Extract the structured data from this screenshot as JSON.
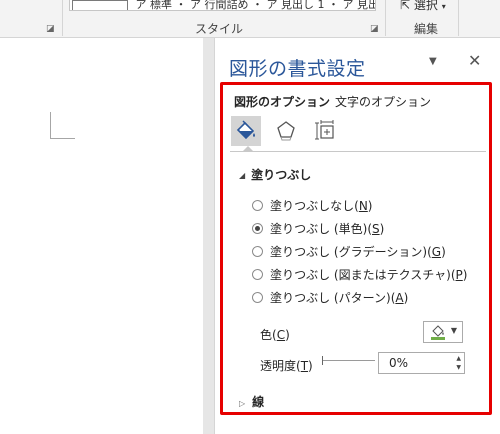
{
  "ribbon": {
    "gallery_text": "ア 標準  ・ ア 行間詰め  ・ ア 見出し 1  ・ ア 見出し 2",
    "group_styles": "スタイル",
    "select_label": "選択",
    "group_edit": "編集"
  },
  "pane": {
    "title": "図形の書式設定",
    "tabs": [
      "図形のオプション",
      "文字のオプション"
    ],
    "icons": [
      "fill-line-icon",
      "effects-icon",
      "size-properties-icon"
    ],
    "fill_section": {
      "heading": "塗りつぶし",
      "options": [
        {
          "label": "塗りつぶしなし",
          "key": "N",
          "checked": false
        },
        {
          "label": "塗りつぶし (単色)",
          "key": "S",
          "checked": true
        },
        {
          "label": "塗りつぶし (グラデーション)",
          "key": "G",
          "checked": false
        },
        {
          "label": "塗りつぶし (図またはテクスチャ)",
          "key": "P",
          "checked": false
        },
        {
          "label": "塗りつぶし (パターン)",
          "key": "A",
          "checked": false
        }
      ],
      "color_label": "色",
      "color_key": "C",
      "transparency_label": "透明度",
      "transparency_key": "T",
      "transparency_value": "0%"
    },
    "line_section": {
      "heading": "線"
    }
  },
  "colors": {
    "title": "#2b579a",
    "highlight_border": "#e60000",
    "fill_swatch": "#70ad47"
  }
}
